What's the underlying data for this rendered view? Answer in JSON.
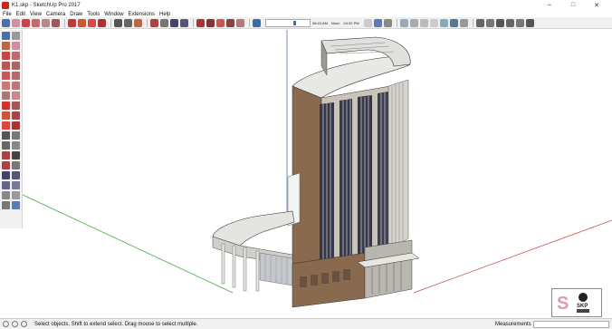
{
  "window": {
    "title": "K1.skp - SketchUp Pro 2017",
    "controls": [
      "–",
      "□",
      "✕"
    ]
  },
  "menu": [
    "File",
    "Edit",
    "View",
    "Camera",
    "Draw",
    "Tools",
    "Window",
    "Extensions",
    "Help"
  ],
  "shadow_settings": {
    "time_start": "06:43 AM",
    "noon": "Noon",
    "time_end": "04:32 PM"
  },
  "status": {
    "hint": "Select objects. Shift to extend select. Drag mouse to select multiple.",
    "measurements_label": "Measurements",
    "measurements_value": ""
  },
  "watermark": {
    "badge": "SKP",
    "letter": "S"
  },
  "colors": {
    "brick": "#8a6a4f",
    "window_dark": "#36384a",
    "concrete": "#d2d2cc",
    "red_axis": "#c85050",
    "green_axis": "#4ca84c",
    "blue_axis": "#5068c8"
  }
}
